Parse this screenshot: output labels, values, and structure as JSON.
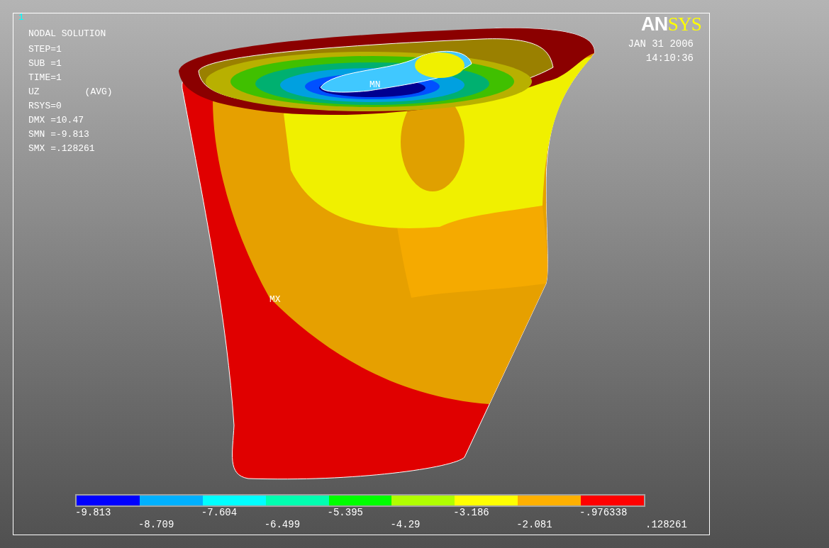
{
  "window_number": "1",
  "title": "NODAL SOLUTION",
  "info": [
    {
      "label": "STEP=1"
    },
    {
      "label": "SUB =1"
    },
    {
      "label": "TIME=1"
    },
    {
      "label": "UZ",
      "note": "(AVG)"
    },
    {
      "label": "RSYS=0"
    },
    {
      "label": "DMX =10.47"
    },
    {
      "label": "SMN =-9.813"
    },
    {
      "label": "SMX =.128261"
    }
  ],
  "logo": {
    "first": "AN",
    "second": "SYS"
  },
  "date": "JAN 31 2006",
  "time": "14:10:36",
  "markers": {
    "min": "MN",
    "max": "MX"
  },
  "legend": {
    "colors": [
      {
        "color": "#0000ff"
      },
      {
        "color": "#00b0ff"
      },
      {
        "color": "#00ffff"
      },
      {
        "color": "#00ffb0"
      },
      {
        "color": "#00ff00"
      },
      {
        "color": "#b0ff00"
      },
      {
        "color": "#ffff00"
      },
      {
        "color": "#ffb000"
      },
      {
        "color": "#ff0000"
      }
    ],
    "labels": [
      "-9.813",
      "-8.709",
      "-7.604",
      "-6.499",
      "-5.395",
      "-4.29",
      "-3.186",
      "-2.081",
      "-.976338",
      ".128261"
    ]
  }
}
